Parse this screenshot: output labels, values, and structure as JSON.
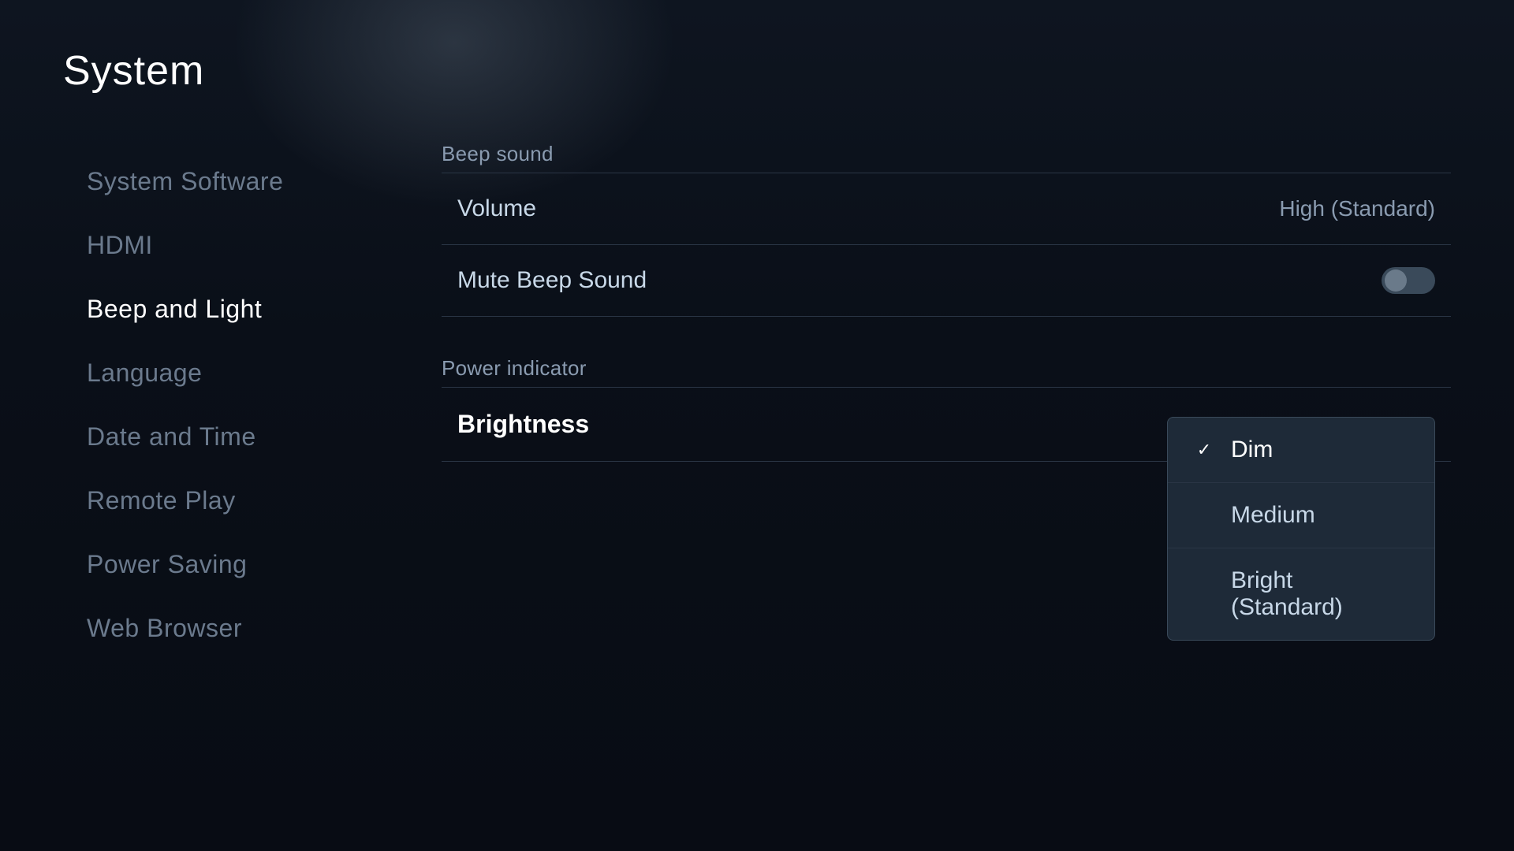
{
  "page": {
    "title": "System"
  },
  "sidebar": {
    "items": [
      {
        "id": "system-software",
        "label": "System Software",
        "active": false
      },
      {
        "id": "hdmi",
        "label": "HDMI",
        "active": false
      },
      {
        "id": "beep-and-light",
        "label": "Beep and Light",
        "active": true
      },
      {
        "id": "language",
        "label": "Language",
        "active": false
      },
      {
        "id": "date-and-time",
        "label": "Date and Time",
        "active": false
      },
      {
        "id": "remote-play",
        "label": "Remote Play",
        "active": false
      },
      {
        "id": "power-saving",
        "label": "Power Saving",
        "active": false
      },
      {
        "id": "web-browser",
        "label": "Web Browser",
        "active": false
      }
    ]
  },
  "main": {
    "beep_sound_section": {
      "label": "Beep sound",
      "volume": {
        "label": "Volume",
        "value": "High (Standard)"
      },
      "mute_beep": {
        "label": "Mute Beep Sound",
        "enabled": false
      }
    },
    "power_indicator_section": {
      "label": "Power indicator",
      "brightness": {
        "label": "Brightness"
      }
    },
    "dropdown": {
      "options": [
        {
          "id": "dim",
          "label": "Dim",
          "selected": true
        },
        {
          "id": "medium",
          "label": "Medium",
          "selected": false
        },
        {
          "id": "bright-standard",
          "label": "Bright (Standard)",
          "selected": false
        }
      ]
    }
  },
  "icons": {
    "checkmark": "✓"
  }
}
